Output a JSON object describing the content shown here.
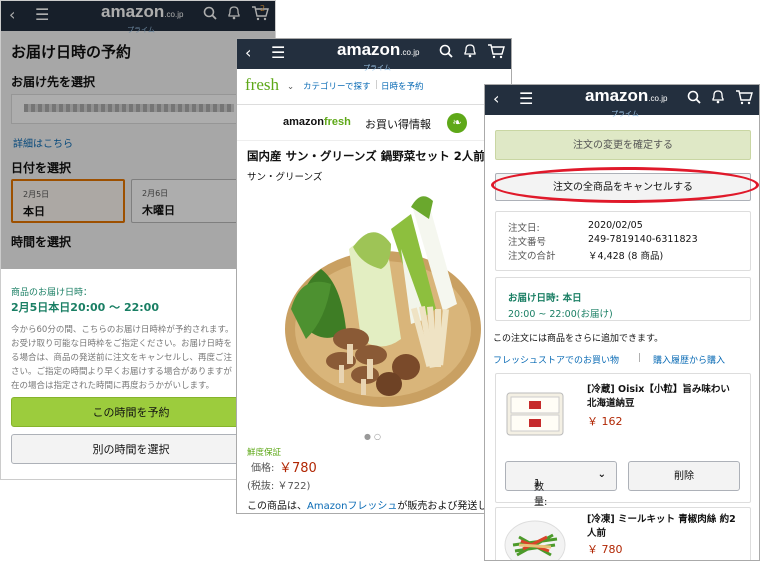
{
  "brand": {
    "logo_text": "amazon",
    "logo_suffix": ".co.jp",
    "logo_sub": "プライム",
    "cart_count": "2"
  },
  "screen1": {
    "title": "お届け日時の予約",
    "address_label": "お届け先を選択",
    "details_link": "詳細はこちら",
    "date_label": "日付を選択",
    "dates": [
      {
        "date": "2月5日",
        "day": "本日",
        "selected": true
      },
      {
        "date": "2月6日",
        "day": "木曜日",
        "selected": false
      }
    ],
    "time_label": "時間を選択",
    "delivery_time_label": "商品のお届け日時：",
    "delivery_time_value": "2月5日本日20:00 ～ 22:00",
    "notes": [
      "今から60分の間、こちらのお届け日時枠が予約されます。",
      "お受け取り可能な日時枠をご指定ください。お届け日時を",
      "る場合は、商品の発送前に注文をキャンセルし、再度ご注",
      "さい。ご指定の時間より早くお届けする場合がありますが",
      "在の場合は指定された時間に再度おうかがいします。"
    ],
    "reserve_button": "この時間を予約",
    "other_time_button": "別の時間を選択"
  },
  "screen2": {
    "fresh_logo": "fresh",
    "nav_categories": "カテゴリーで探す",
    "nav_schedule": "日時を予約",
    "amazonfresh_a": "amazon",
    "amazonfresh_b": "fresh",
    "deals_label": "お買い得情報",
    "product_title": "国内産 サン・グリーンズ 鍋野菜セット 2人前",
    "brand_name": "サン・グリーンズ",
    "freshness_note": "鮮度保証",
    "price_label": "価格:",
    "price": "￥780",
    "tax_excluded": "(税抜: ￥722)",
    "sold_by_prefix": "この商品は、",
    "sold_by_link": "Amazonフレッシュ",
    "sold_by_suffix": "が販売および発送します。"
  },
  "screen3": {
    "confirm_button": "注文の変更を確定する",
    "cancel_all_button": "注文の全商品をキャンセルする",
    "order": [
      {
        "label": "注文日:",
        "value": "2020/02/05"
      },
      {
        "label": "注文番号",
        "value": "249-7819140-6311823"
      },
      {
        "label": "注文の合計",
        "value": "￥4,428 (8 商品)"
      }
    ],
    "delivery_date": "お届け日時: 本日",
    "delivery_time": "20:00 ~ 22:00(お届け)",
    "add_note": "この注文には商品をさらに追加できます。",
    "link_fresh": "フレッシュストアでのお買い物",
    "separator": "|",
    "link_history": "購入履歴から購入",
    "items": [
      {
        "name": "[冷蔵] Oisix【小粒】旨み味わい北海道納豆",
        "price": "￥ 162"
      },
      {
        "name": "[冷凍] ミールキット 青椒肉絲 約2人前",
        "price": "￥ 780"
      }
    ],
    "quantity_label": "数量:",
    "quantity_value": "1",
    "delete_button": "削除"
  },
  "colors": {
    "nav_bg": "#232f3e",
    "fresh_green": "#5ea818",
    "price_red": "#b12704",
    "highlight_red": "#e0192a"
  }
}
